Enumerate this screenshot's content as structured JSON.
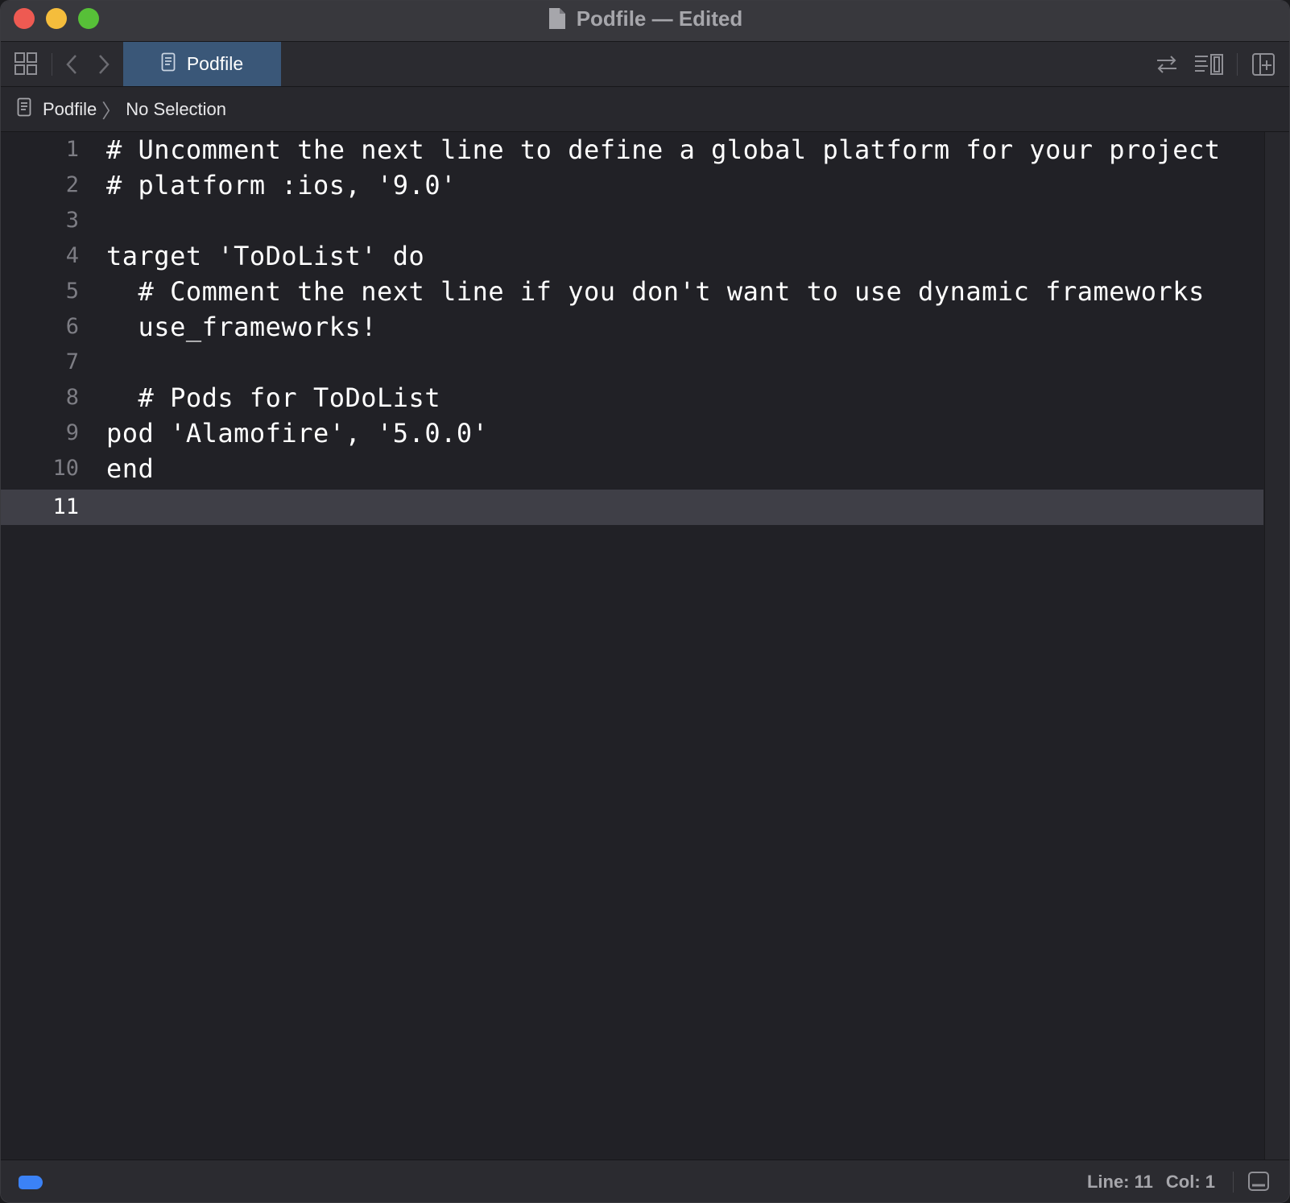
{
  "window": {
    "title": "Podfile — Edited"
  },
  "toolbar": {
    "active_tab_label": "Podfile"
  },
  "jumpbar": {
    "file_label": "Podfile",
    "selection_label": "No Selection"
  },
  "editor": {
    "current_line": 11,
    "lines": [
      {
        "num": "1",
        "text": "# Uncomment the next line to define a global platform for your project"
      },
      {
        "num": "2",
        "text": "# platform :ios, '9.0'"
      },
      {
        "num": "3",
        "text": ""
      },
      {
        "num": "4",
        "text": "target 'ToDoList' do"
      },
      {
        "num": "5",
        "text": "  # Comment the next line if you don't want to use dynamic frameworks"
      },
      {
        "num": "6",
        "text": "  use_frameworks!"
      },
      {
        "num": "7",
        "text": ""
      },
      {
        "num": "8",
        "text": "  # Pods for ToDoList"
      },
      {
        "num": "9",
        "text": "pod 'Alamofire', '5.0.0'"
      },
      {
        "num": "10",
        "text": "end"
      },
      {
        "num": "11",
        "text": ""
      }
    ]
  },
  "status": {
    "line_label": "Line: 11",
    "col_label": "Col: 1"
  },
  "colors": {
    "accent": "#3a5778",
    "status_indicator": "#3b82f6",
    "close": "#ee5a52",
    "minimize": "#f5bd3c",
    "maximize": "#57c038"
  },
  "icons": [
    "document-icon",
    "grid-icon",
    "back-chevron-icon",
    "forward-chevron-icon",
    "swap-arrows-icon",
    "minimap-icon",
    "add-editor-icon",
    "panel-toggle-icon"
  ]
}
